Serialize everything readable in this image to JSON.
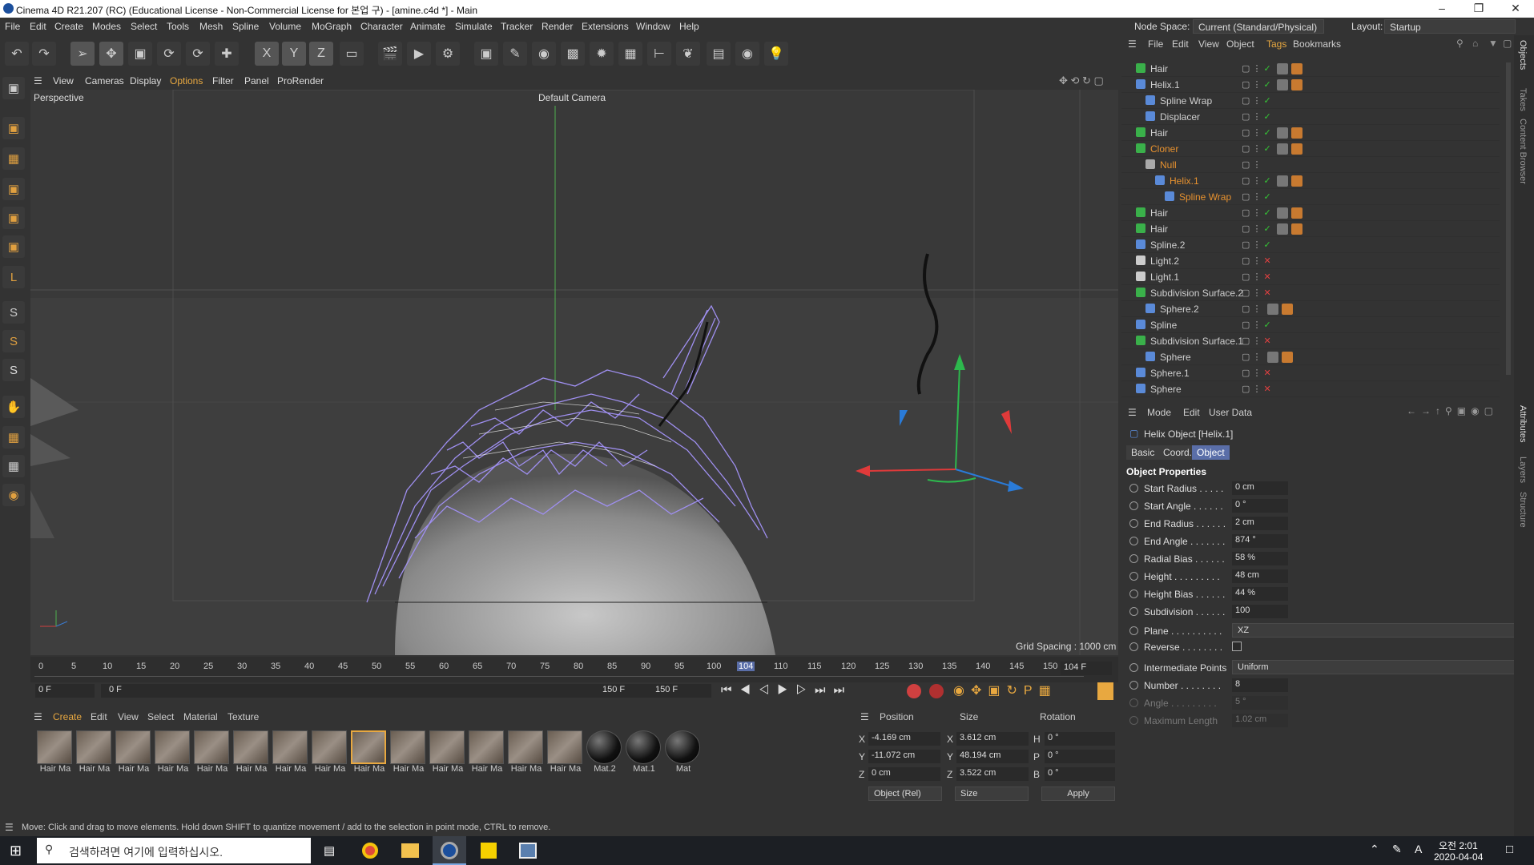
{
  "window": {
    "title": "Cinema 4D R21.207 (RC) (Educational License - Non-Commercial License for 본업 구) - [amine.c4d *] - Main"
  },
  "menu": [
    "File",
    "Edit",
    "Create",
    "Modes",
    "Select",
    "Tools",
    "Mesh",
    "Spline",
    "Volume",
    "MoGraph",
    "Character",
    "Animate",
    "Simulate",
    "Tracker",
    "Render",
    "Extensions",
    "Window",
    "Help"
  ],
  "nodespace": {
    "label": "Node Space:",
    "value": "Current (Standard/Physical)",
    "layout_label": "Layout:",
    "layout_value": "Startup"
  },
  "viewport": {
    "menu": [
      "View",
      "Cameras",
      "Display",
      "Options",
      "Filter",
      "Panel",
      "ProRender"
    ],
    "name": "Perspective",
    "camera": "Default Camera",
    "grid": "Grid Spacing : 1000 cm"
  },
  "timeline": {
    "ticks": [
      "0",
      "5",
      "10",
      "15",
      "20",
      "25",
      "30",
      "35",
      "40",
      "45",
      "50",
      "55",
      "60",
      "65",
      "70",
      "75",
      "80",
      "85",
      "90",
      "95",
      "100",
      "104",
      "110",
      "115",
      "120",
      "125",
      "130",
      "135",
      "140",
      "145",
      "150"
    ],
    "current": "104 F",
    "start": "0 F",
    "range_start": "0 F",
    "range_end": "150 F",
    "end": "150 F"
  },
  "materials": {
    "menu": [
      "Create",
      "Edit",
      "View",
      "Select",
      "Material",
      "Texture"
    ],
    "items": [
      "Hair Ma",
      "Hair Ma",
      "Hair Ma",
      "Hair Ma",
      "Hair Ma",
      "Hair Ma",
      "Hair Ma",
      "Hair Ma",
      "Hair Ma",
      "Hair Ma",
      "Hair Ma",
      "Hair Ma",
      "Hair Ma",
      "Hair Ma",
      "Mat.2",
      "Mat.1",
      "Mat"
    ]
  },
  "coords": {
    "headers": [
      "Position",
      "Size",
      "Rotation"
    ],
    "rows": [
      {
        "axis": "X",
        "pos": "-4.169 cm",
        "size_axis": "X",
        "size": "3.612 cm",
        "rot_axis": "H",
        "rot": "0 °"
      },
      {
        "axis": "Y",
        "pos": "-11.072 cm",
        "size_axis": "Y",
        "size": "48.194 cm",
        "rot_axis": "P",
        "rot": "0 °"
      },
      {
        "axis": "Z",
        "pos": "0 cm",
        "size_axis": "Z",
        "size": "3.522 cm",
        "rot_axis": "B",
        "rot": "0 °"
      }
    ],
    "mode": "Object (Rel)",
    "size_mode": "Size",
    "apply": "Apply"
  },
  "status": "Move: Click and drag to move elements. Hold down SHIFT to quantize movement / add to the selection in point mode, CTRL to remove.",
  "objmgr": {
    "menu": [
      "File",
      "Edit",
      "View",
      "Object",
      "Tags",
      "Bookmarks"
    ],
    "rows": [
      {
        "name": "Hair",
        "color": "#cfcfcf"
      },
      {
        "name": "Helix.1",
        "color": "#cfcfcf"
      },
      {
        "name": "Spline Wrap",
        "color": "#cfcfcf"
      },
      {
        "name": "Displacer",
        "color": "#cfcfcf"
      },
      {
        "name": "Hair",
        "color": "#cfcfcf"
      },
      {
        "name": "Cloner",
        "color": "#e8922f"
      },
      {
        "name": "Null",
        "color": "#e8922f"
      },
      {
        "name": "Helix.1",
        "color": "#e8922f"
      },
      {
        "name": "Spline Wrap",
        "color": "#e8922f"
      },
      {
        "name": "Hair",
        "color": "#cfcfcf"
      },
      {
        "name": "Hair",
        "color": "#cfcfcf"
      },
      {
        "name": "Spline.2",
        "color": "#cfcfcf"
      },
      {
        "name": "Light.2",
        "color": "#cfcfcf"
      },
      {
        "name": "Light.1",
        "color": "#cfcfcf"
      },
      {
        "name": "Subdivision Surface.2",
        "color": "#cfcfcf"
      },
      {
        "name": "Sphere.2",
        "color": "#cfcfcf"
      },
      {
        "name": "Spline",
        "color": "#cfcfcf"
      },
      {
        "name": "Subdivision Surface.1",
        "color": "#cfcfcf"
      },
      {
        "name": "Sphere",
        "color": "#cfcfcf"
      },
      {
        "name": "Sphere.1",
        "color": "#cfcfcf"
      },
      {
        "name": "Sphere",
        "color": "#cfcfcf"
      }
    ]
  },
  "attr": {
    "menu": [
      "Mode",
      "Edit",
      "User Data"
    ],
    "object": "Helix Object [Helix.1]",
    "tabs": [
      "Basic",
      "Coord.",
      "Object"
    ],
    "section": "Object Properties",
    "props": [
      {
        "label": "Start Radius . . . . .",
        "value": "0 cm"
      },
      {
        "label": "Start Angle . . . . . .",
        "value": "0 °"
      },
      {
        "label": "End Radius . . . . . .",
        "value": "2 cm"
      },
      {
        "label": "End Angle . . . . . . .",
        "value": "874 °"
      },
      {
        "label": "Radial Bias . . . . . .",
        "value": "58 %"
      },
      {
        "label": "Height . . . . . . . . .",
        "value": "48 cm"
      },
      {
        "label": "Height Bias . . . . . .",
        "value": "44 %"
      },
      {
        "label": "Subdivision . . . . . .",
        "value": "100"
      }
    ],
    "plane_label": "Plane . . . . . . . . . .",
    "plane": "XZ",
    "reverse_label": "Reverse . . . . . . . .",
    "ip_label": "Intermediate Points",
    "ip": "Uniform",
    "number_label": "Number . . . . . . . .",
    "number": "8",
    "angle_label": "Angle . . . . . . . . .",
    "angle": "5 °",
    "maxlen_label": "Maximum Length",
    "maxlen": "1.02 cm"
  },
  "rightstrip": [
    "Objects",
    "Takes",
    "Content Browser",
    "Attributes",
    "Layers",
    "Structure"
  ],
  "taskbar": {
    "search": "검색하려면 여기에 입력하십시오.",
    "time": "오전 2:01",
    "date": "2020-04-04",
    "lang": "A"
  }
}
